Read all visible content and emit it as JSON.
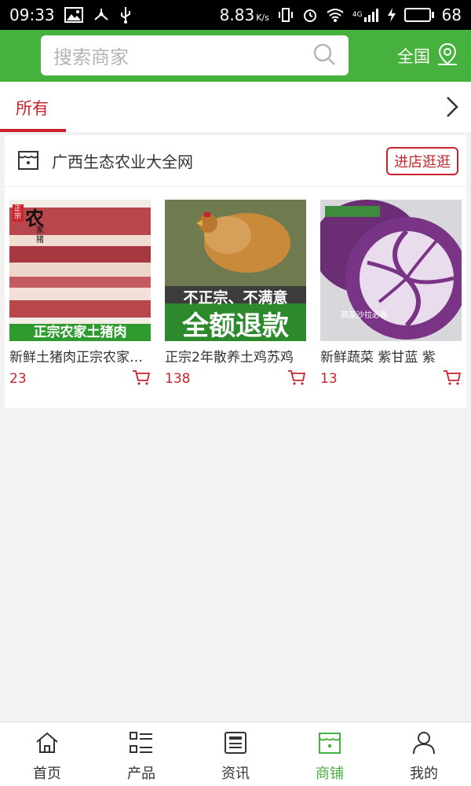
{
  "status_bar": {
    "time": "09:33",
    "speed": "8.83",
    "speed_unit": "K/s",
    "network": "4G",
    "battery": "68",
    "battery_level": 0.68
  },
  "header": {
    "search_placeholder": "搜索商家",
    "region_label": "全国"
  },
  "category_tabs": [
    {
      "label": "所有",
      "active": true
    }
  ],
  "shop": {
    "name": "广西生态农业大全网",
    "visit_label": "进店逛逛",
    "products": [
      {
        "title": "新鲜土猪肉正宗农家土猪肉",
        "price": "23",
        "image_text": {
          "badge": "正宗",
          "big": "农",
          "sub": "家猪",
          "caption": "正宗农家土猪肉"
        }
      },
      {
        "title": "正宗2年散养土鸡苏鸡",
        "price": "138",
        "image_text": {
          "line1": "不正宗、不满意",
          "line2": "全额退款"
        }
      },
      {
        "title": "新鲜蔬菜 紫甘蓝 紫",
        "price": "13",
        "image_text": {
          "caption": "蔬菜沙拉必备"
        }
      }
    ]
  },
  "bottom_nav": [
    {
      "label": "首页",
      "icon": "home-icon",
      "active": false
    },
    {
      "label": "产品",
      "icon": "list-icon",
      "active": false
    },
    {
      "label": "资讯",
      "icon": "news-icon",
      "active": false
    },
    {
      "label": "商铺",
      "icon": "shop-icon",
      "active": true
    },
    {
      "label": "我的",
      "icon": "user-icon",
      "active": false
    }
  ],
  "colors": {
    "brand_green": "#46b13d",
    "accent_red": "#c9232d"
  }
}
